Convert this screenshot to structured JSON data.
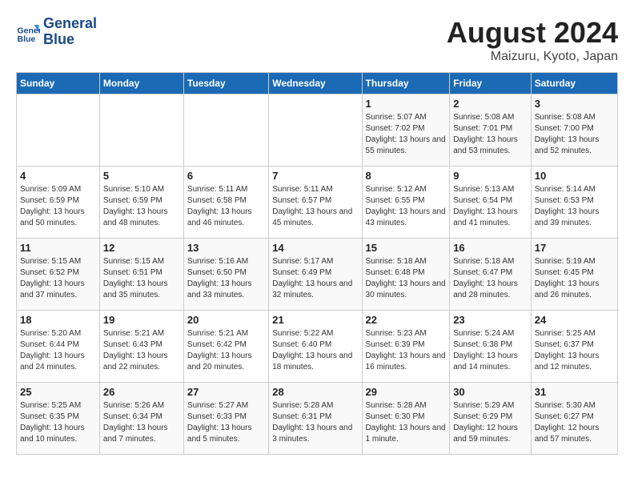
{
  "header": {
    "logo_line1": "General",
    "logo_line2": "Blue",
    "main_title": "August 2024",
    "subtitle": "Maizuru, Kyoto, Japan"
  },
  "weekdays": [
    "Sunday",
    "Monday",
    "Tuesday",
    "Wednesday",
    "Thursday",
    "Friday",
    "Saturday"
  ],
  "weeks": [
    [
      {
        "day": "",
        "sunrise": "",
        "sunset": "",
        "daylight": ""
      },
      {
        "day": "",
        "sunrise": "",
        "sunset": "",
        "daylight": ""
      },
      {
        "day": "",
        "sunrise": "",
        "sunset": "",
        "daylight": ""
      },
      {
        "day": "",
        "sunrise": "",
        "sunset": "",
        "daylight": ""
      },
      {
        "day": "1",
        "sunrise": "Sunrise: 5:07 AM",
        "sunset": "Sunset: 7:02 PM",
        "daylight": "Daylight: 13 hours and 55 minutes."
      },
      {
        "day": "2",
        "sunrise": "Sunrise: 5:08 AM",
        "sunset": "Sunset: 7:01 PM",
        "daylight": "Daylight: 13 hours and 53 minutes."
      },
      {
        "day": "3",
        "sunrise": "Sunrise: 5:08 AM",
        "sunset": "Sunset: 7:00 PM",
        "daylight": "Daylight: 13 hours and 52 minutes."
      }
    ],
    [
      {
        "day": "4",
        "sunrise": "Sunrise: 5:09 AM",
        "sunset": "Sunset: 6:59 PM",
        "daylight": "Daylight: 13 hours and 50 minutes."
      },
      {
        "day": "5",
        "sunrise": "Sunrise: 5:10 AM",
        "sunset": "Sunset: 6:59 PM",
        "daylight": "Daylight: 13 hours and 48 minutes."
      },
      {
        "day": "6",
        "sunrise": "Sunrise: 5:11 AM",
        "sunset": "Sunset: 6:58 PM",
        "daylight": "Daylight: 13 hours and 46 minutes."
      },
      {
        "day": "7",
        "sunrise": "Sunrise: 5:11 AM",
        "sunset": "Sunset: 6:57 PM",
        "daylight": "Daylight: 13 hours and 45 minutes."
      },
      {
        "day": "8",
        "sunrise": "Sunrise: 5:12 AM",
        "sunset": "Sunset: 6:55 PM",
        "daylight": "Daylight: 13 hours and 43 minutes."
      },
      {
        "day": "9",
        "sunrise": "Sunrise: 5:13 AM",
        "sunset": "Sunset: 6:54 PM",
        "daylight": "Daylight: 13 hours and 41 minutes."
      },
      {
        "day": "10",
        "sunrise": "Sunrise: 5:14 AM",
        "sunset": "Sunset: 6:53 PM",
        "daylight": "Daylight: 13 hours and 39 minutes."
      }
    ],
    [
      {
        "day": "11",
        "sunrise": "Sunrise: 5:15 AM",
        "sunset": "Sunset: 6:52 PM",
        "daylight": "Daylight: 13 hours and 37 minutes."
      },
      {
        "day": "12",
        "sunrise": "Sunrise: 5:15 AM",
        "sunset": "Sunset: 6:51 PM",
        "daylight": "Daylight: 13 hours and 35 minutes."
      },
      {
        "day": "13",
        "sunrise": "Sunrise: 5:16 AM",
        "sunset": "Sunset: 6:50 PM",
        "daylight": "Daylight: 13 hours and 33 minutes."
      },
      {
        "day": "14",
        "sunrise": "Sunrise: 5:17 AM",
        "sunset": "Sunset: 6:49 PM",
        "daylight": "Daylight: 13 hours and 32 minutes."
      },
      {
        "day": "15",
        "sunrise": "Sunrise: 5:18 AM",
        "sunset": "Sunset: 6:48 PM",
        "daylight": "Daylight: 13 hours and 30 minutes."
      },
      {
        "day": "16",
        "sunrise": "Sunrise: 5:18 AM",
        "sunset": "Sunset: 6:47 PM",
        "daylight": "Daylight: 13 hours and 28 minutes."
      },
      {
        "day": "17",
        "sunrise": "Sunrise: 5:19 AM",
        "sunset": "Sunset: 6:45 PM",
        "daylight": "Daylight: 13 hours and 26 minutes."
      }
    ],
    [
      {
        "day": "18",
        "sunrise": "Sunrise: 5:20 AM",
        "sunset": "Sunset: 6:44 PM",
        "daylight": "Daylight: 13 hours and 24 minutes."
      },
      {
        "day": "19",
        "sunrise": "Sunrise: 5:21 AM",
        "sunset": "Sunset: 6:43 PM",
        "daylight": "Daylight: 13 hours and 22 minutes."
      },
      {
        "day": "20",
        "sunrise": "Sunrise: 5:21 AM",
        "sunset": "Sunset: 6:42 PM",
        "daylight": "Daylight: 13 hours and 20 minutes."
      },
      {
        "day": "21",
        "sunrise": "Sunrise: 5:22 AM",
        "sunset": "Sunset: 6:40 PM",
        "daylight": "Daylight: 13 hours and 18 minutes."
      },
      {
        "day": "22",
        "sunrise": "Sunrise: 5:23 AM",
        "sunset": "Sunset: 6:39 PM",
        "daylight": "Daylight: 13 hours and 16 minutes."
      },
      {
        "day": "23",
        "sunrise": "Sunrise: 5:24 AM",
        "sunset": "Sunset: 6:38 PM",
        "daylight": "Daylight: 13 hours and 14 minutes."
      },
      {
        "day": "24",
        "sunrise": "Sunrise: 5:25 AM",
        "sunset": "Sunset: 6:37 PM",
        "daylight": "Daylight: 13 hours and 12 minutes."
      }
    ],
    [
      {
        "day": "25",
        "sunrise": "Sunrise: 5:25 AM",
        "sunset": "Sunset: 6:35 PM",
        "daylight": "Daylight: 13 hours and 10 minutes."
      },
      {
        "day": "26",
        "sunrise": "Sunrise: 5:26 AM",
        "sunset": "Sunset: 6:34 PM",
        "daylight": "Daylight: 13 hours and 7 minutes."
      },
      {
        "day": "27",
        "sunrise": "Sunrise: 5:27 AM",
        "sunset": "Sunset: 6:33 PM",
        "daylight": "Daylight: 13 hours and 5 minutes."
      },
      {
        "day": "28",
        "sunrise": "Sunrise: 5:28 AM",
        "sunset": "Sunset: 6:31 PM",
        "daylight": "Daylight: 13 hours and 3 minutes."
      },
      {
        "day": "29",
        "sunrise": "Sunrise: 5:28 AM",
        "sunset": "Sunset: 6:30 PM",
        "daylight": "Daylight: 13 hours and 1 minute."
      },
      {
        "day": "30",
        "sunrise": "Sunrise: 5:29 AM",
        "sunset": "Sunset: 6:29 PM",
        "daylight": "Daylight: 12 hours and 59 minutes."
      },
      {
        "day": "31",
        "sunrise": "Sunrise: 5:30 AM",
        "sunset": "Sunset: 6:27 PM",
        "daylight": "Daylight: 12 hours and 57 minutes."
      }
    ]
  ]
}
